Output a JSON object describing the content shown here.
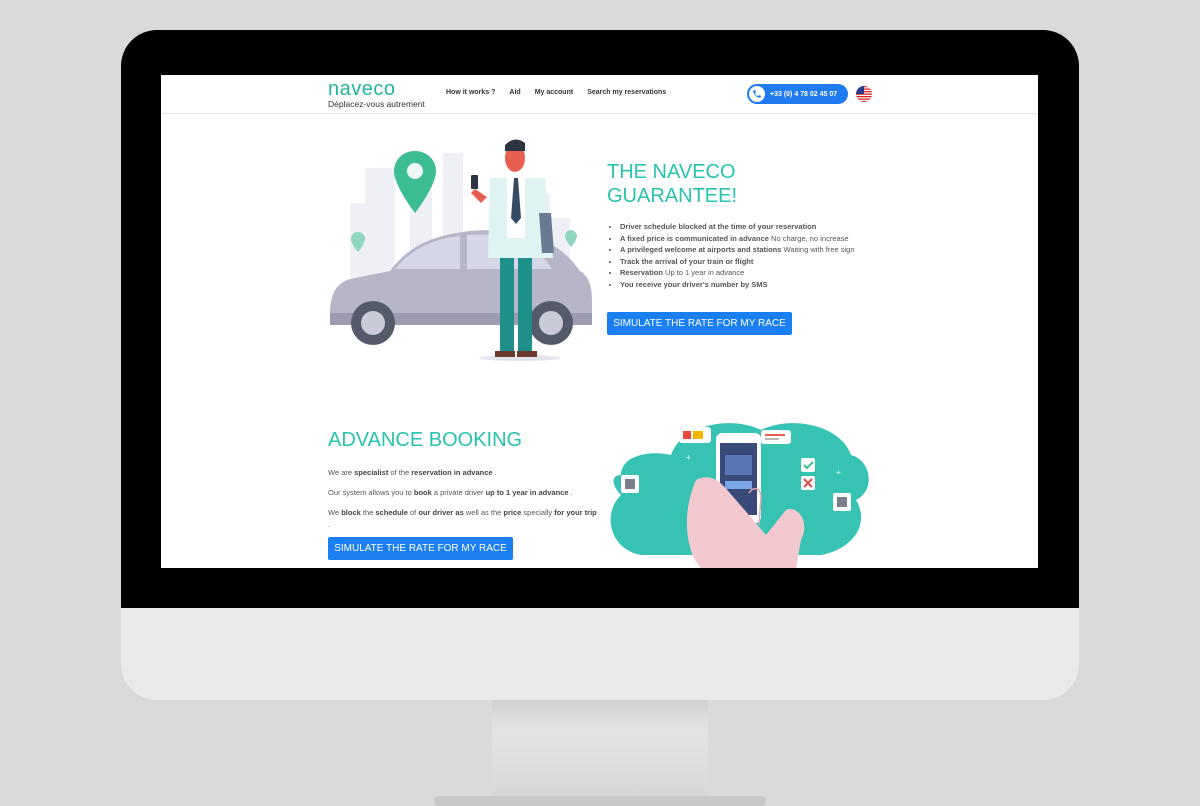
{
  "brand": {
    "name": "naveco",
    "tagline": "Déplacez-vous autrement",
    "accent_color": "#27c3b0",
    "button_color": "#1a7ff0"
  },
  "nav": {
    "items": [
      "How it works ?",
      "Aid",
      "My account",
      "Search my reservations"
    ]
  },
  "header": {
    "phone": "+33 (0) 4 78 02 45 07",
    "phone_icon": "phone-icon",
    "language_icon": "us-flag-icon"
  },
  "guarantee": {
    "title": "THE NAVECO GUARANTEE!",
    "items": [
      {
        "bold": "Driver schedule blocked at the time of your reservation",
        "text": ""
      },
      {
        "bold": "A fixed price is communicated in advance",
        "text": " No charge, no increase"
      },
      {
        "bold": "A privileged welcome at airports and stations",
        "text": " Waiting with free sign"
      },
      {
        "bold": "Track the arrival of your train or flight",
        "text": ""
      },
      {
        "bold": "Reservation",
        "text": " Up to 1 year in advance"
      },
      {
        "bold": "You receive your driver's number by SMS",
        "text": ""
      }
    ],
    "button": "SIMULATE THE RATE FOR MY RACE"
  },
  "advance": {
    "title": "ADVANCE BOOKING",
    "p1": {
      "a": "We are ",
      "b": "specialist",
      "c": " of the ",
      "d": "reservation in advance",
      "e": " ."
    },
    "p2": {
      "a": "Our system allows you to ",
      "b": "book",
      "c": " a private driver ",
      "d": "up to 1 year in advance",
      "e": " ."
    },
    "p3": {
      "a": "We ",
      "b": "block",
      "c": " the ",
      "d": "schedule",
      "e": " of ",
      "f": "our driver as",
      "g": " well as the ",
      "h": "price",
      "i": " specially ",
      "j": "for your trip",
      "k": " ."
    },
    "button": "SIMULATE THE RATE FOR MY RACE"
  }
}
